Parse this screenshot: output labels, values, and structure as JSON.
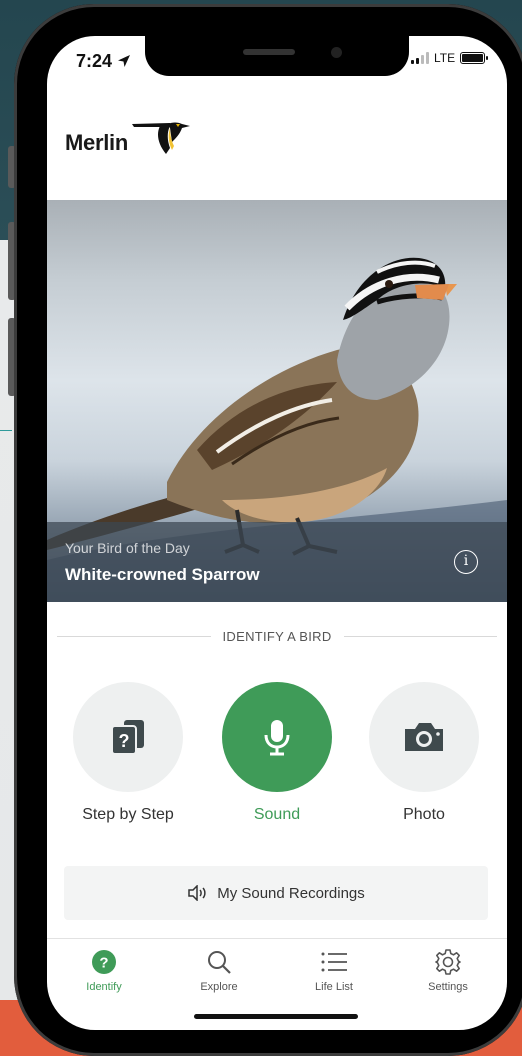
{
  "status_bar": {
    "time": "7:24",
    "network": "LTE"
  },
  "app": {
    "logo_text": "Merlin"
  },
  "bird_of_day": {
    "subtitle": "Your Bird of the Day",
    "name": "White-crowned Sparrow"
  },
  "identify": {
    "heading": "IDENTIFY A BIRD",
    "modes": [
      {
        "label": "Step by Step",
        "icon": "question-cards-icon"
      },
      {
        "label": "Sound",
        "icon": "microphone-icon"
      },
      {
        "label": "Photo",
        "icon": "camera-icon"
      }
    ]
  },
  "recordings": {
    "label": "My Sound Recordings",
    "icon": "speaker-icon"
  },
  "tabs": [
    {
      "label": "Identify",
      "icon": "question-icon",
      "active": true
    },
    {
      "label": "Explore",
      "icon": "search-icon",
      "active": false
    },
    {
      "label": "Life List",
      "icon": "list-icon",
      "active": false
    },
    {
      "label": "Settings",
      "icon": "gear-icon",
      "active": false
    }
  ],
  "colors": {
    "accent_green": "#3f9b58",
    "inactive_circle": "#eef0f0",
    "orange_strip": "#e25d3d"
  }
}
